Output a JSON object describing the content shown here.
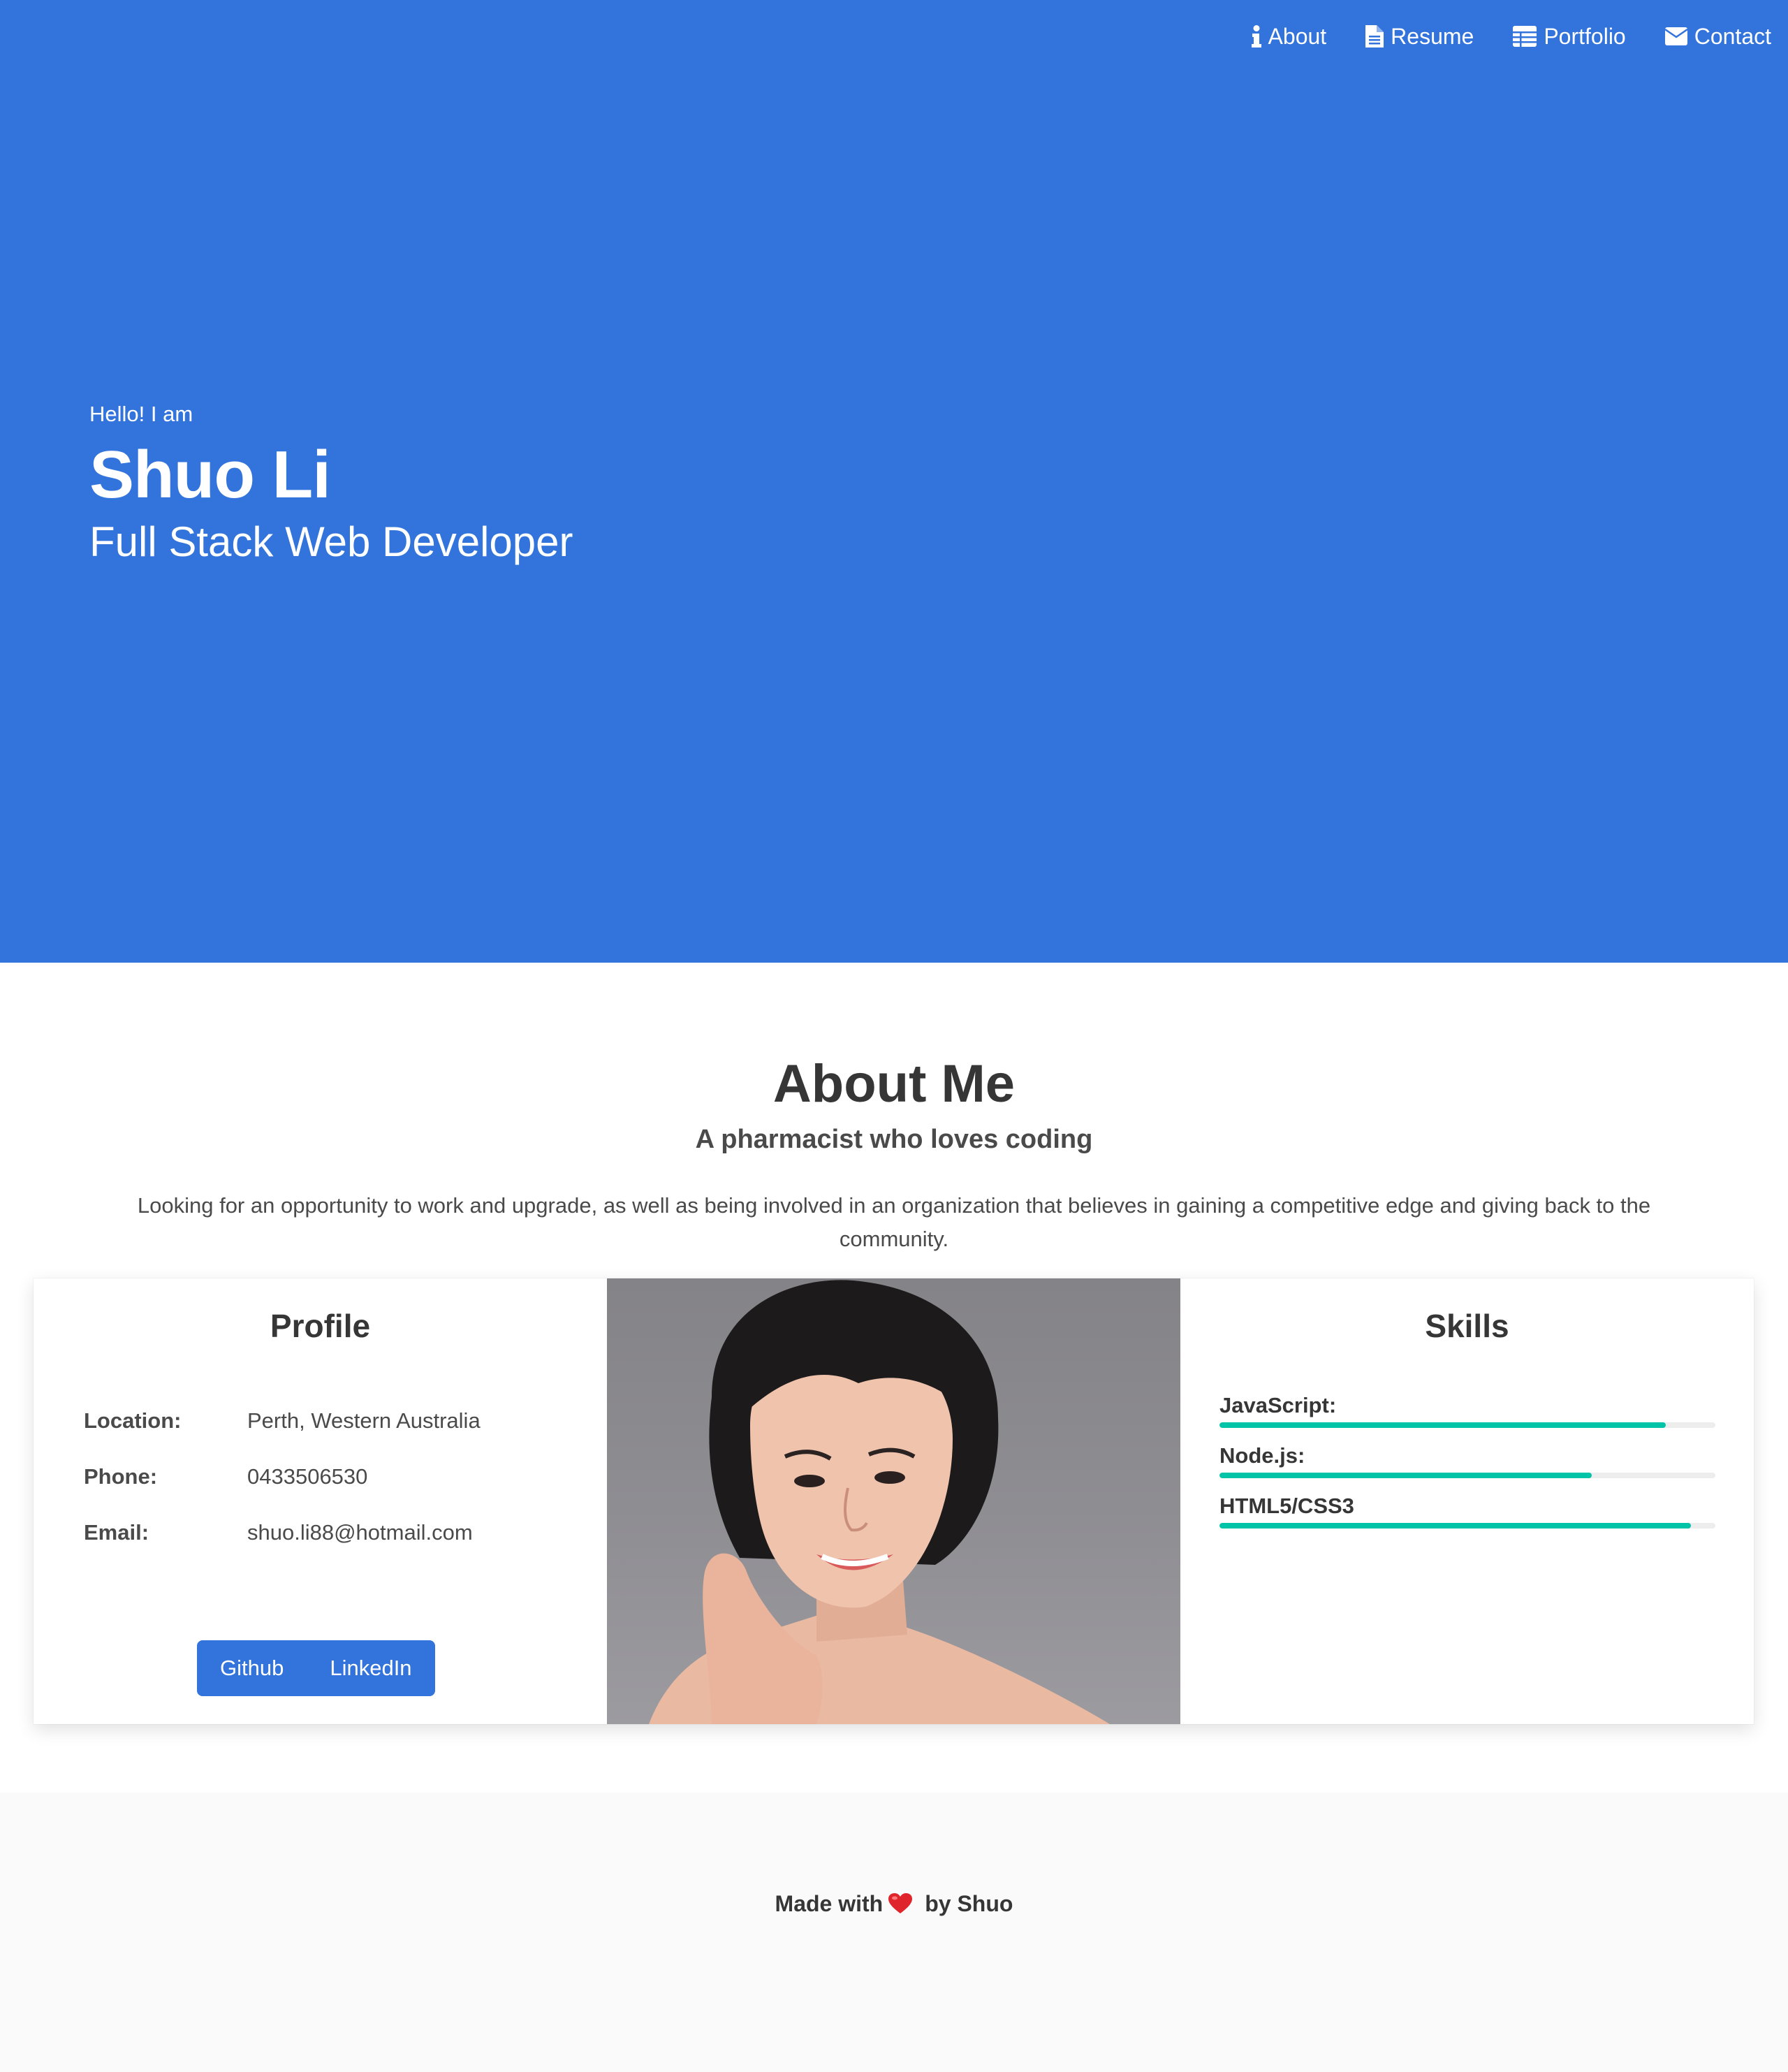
{
  "nav": {
    "items": [
      {
        "label": "About",
        "icon": "info-icon"
      },
      {
        "label": "Resume",
        "icon": "file-icon"
      },
      {
        "label": "Portfolio",
        "icon": "table-icon"
      },
      {
        "label": "Contact",
        "icon": "envelope-icon"
      }
    ]
  },
  "hero": {
    "greeting": "Hello! I am",
    "name": "Shuo Li",
    "subtitle": "Full Stack Web Developer",
    "background_color": "#3273dc"
  },
  "about": {
    "title": "About Me",
    "subtitle": "A pharmacist who loves coding",
    "description": "Looking for an opportunity to work and upgrade, as well as being involved in an organization that believes in gaining a competitive edge and giving back to the community."
  },
  "profile": {
    "title": "Profile",
    "rows": [
      {
        "label": "Location:",
        "value": "Perth, Western Australia"
      },
      {
        "label": "Phone:",
        "value": "0433506530"
      },
      {
        "label": "Email:",
        "value": "shuo.li88@hotmail.com"
      }
    ],
    "buttons": {
      "github": "Github",
      "linkedin": "LinkedIn"
    }
  },
  "skills": {
    "title": "Skills",
    "items": [
      {
        "name": "JavaScript:",
        "level": 0.9
      },
      {
        "name": "Node.js:",
        "level": 0.75
      },
      {
        "name": "HTML5/CSS3",
        "level": 0.95
      }
    ],
    "bar_color": "#00c4a7"
  },
  "footer": {
    "prefix": "Made with",
    "icon": "heart-icon",
    "suffix": "by Shuo"
  }
}
